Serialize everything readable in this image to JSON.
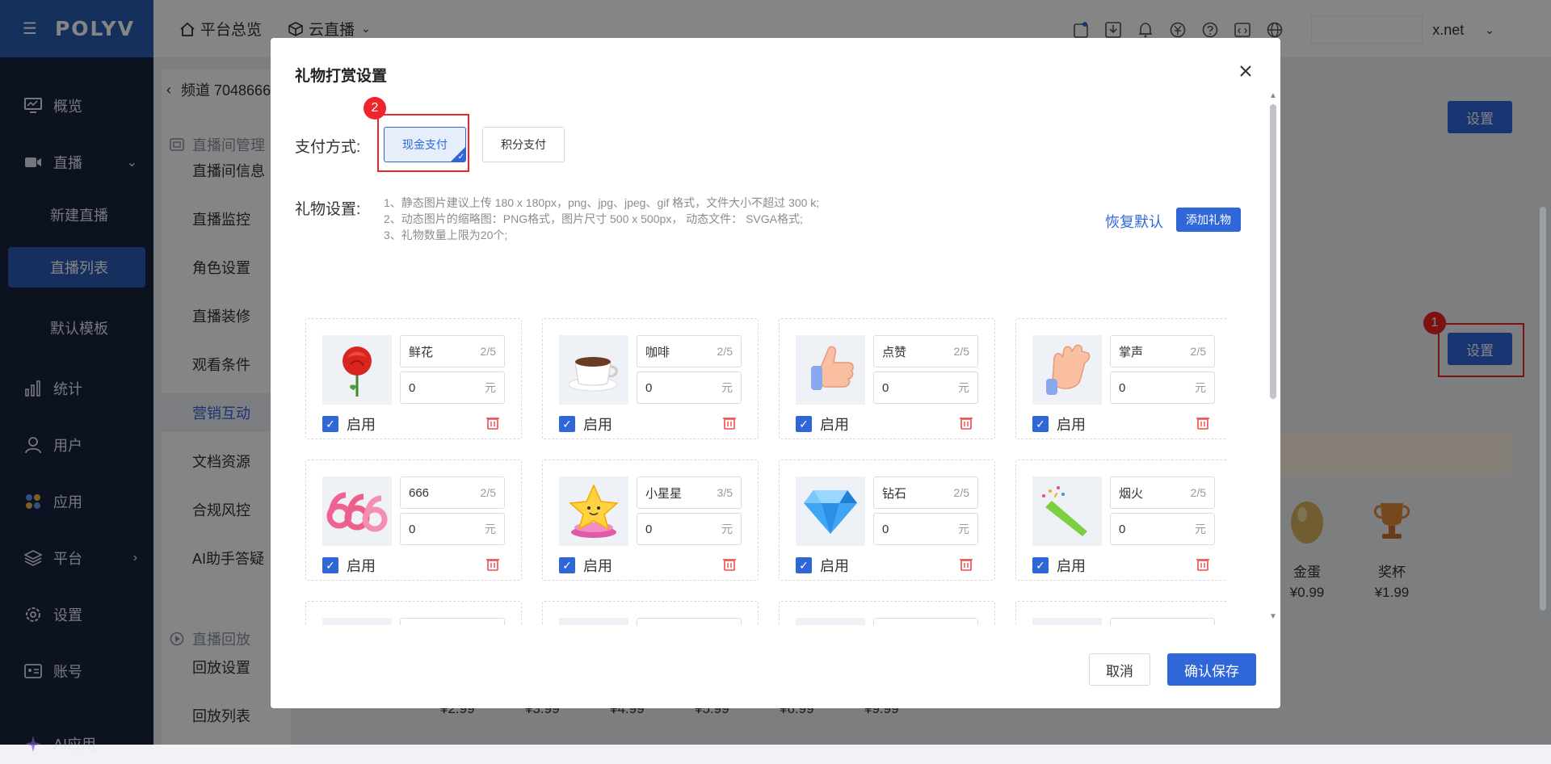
{
  "brand": {
    "logo": "POLYV"
  },
  "sidebar": {
    "items": [
      {
        "label": "概览",
        "icon": "monitor-icon"
      },
      {
        "label": "直播",
        "icon": "video-icon"
      },
      {
        "label": "统计",
        "icon": "bar-chart-icon"
      },
      {
        "label": "用户",
        "icon": "user-icon"
      },
      {
        "label": "应用",
        "icon": "apps-icon"
      },
      {
        "label": "平台",
        "icon": "layers-icon"
      },
      {
        "label": "设置",
        "icon": "gear-icon"
      },
      {
        "label": "账号",
        "icon": "id-card-icon"
      },
      {
        "label": "AI应用",
        "icon": "sparkle-icon"
      }
    ],
    "live_sub": [
      "新建直播",
      "直播列表",
      "默认模板"
    ],
    "active_sub": "直播列表"
  },
  "topbar": {
    "links": [
      "平台总览",
      "云直播"
    ],
    "user_domain": "x.net"
  },
  "channel": {
    "title": "频道 7048666",
    "group1": "直播间管理",
    "items": [
      "直播间信息",
      "直播监控",
      "角色设置",
      "直播装修",
      "观看条件",
      "营销互动",
      "文档资源",
      "合规风控",
      "AI助手答疑"
    ],
    "active": "营销互动",
    "group2": "直播回放",
    "items2": [
      "回放设置",
      "回放列表"
    ]
  },
  "background": {
    "settings_button": "设置",
    "gifts": [
      {
        "name": "金蛋",
        "price": "¥0.99"
      },
      {
        "name": "奖杯",
        "price": "¥1.99"
      }
    ],
    "price_row": [
      "¥2.99",
      "¥3.99",
      "¥4.99",
      "¥5.99",
      "¥6.99",
      "¥9.99"
    ]
  },
  "annotations": [
    "1",
    "2"
  ],
  "dialog": {
    "title": "礼物打赏设置",
    "payment_label": "支付方式:",
    "payment_options": [
      "现金支付",
      "积分支付"
    ],
    "gift_label": "礼物设置:",
    "rules": [
      "1、静态图片建议上传 180 x 180px，png、jpg、jpeg、gif 格式，文件大小不超过 300 k;",
      "2、动态图片的缩略图：PNG格式，图片尺寸 500 x 500px， 动态文件： SVGA格式;",
      "3、礼物数量上限为20个;"
    ],
    "restore_default": "恢复默认",
    "add_gift": "添加礼物",
    "enable_label": "启用",
    "currency_unit": "元",
    "gifts": [
      {
        "name": "鲜花",
        "count": "2/5",
        "price": "0",
        "icon": "rose-icon"
      },
      {
        "name": "咖啡",
        "count": "2/5",
        "price": "0",
        "icon": "coffee-icon"
      },
      {
        "name": "点赞",
        "count": "2/5",
        "price": "0",
        "icon": "thumbs-up-icon"
      },
      {
        "name": "掌声",
        "count": "2/5",
        "price": "0",
        "icon": "clap-icon"
      },
      {
        "name": "666",
        "count": "2/5",
        "price": "0",
        "icon": "number-666-icon"
      },
      {
        "name": "小星星",
        "count": "3/5",
        "price": "0",
        "icon": "star-icon"
      },
      {
        "name": "钻石",
        "count": "2/5",
        "price": "0",
        "icon": "diamond-icon"
      },
      {
        "name": "烟火",
        "count": "2/5",
        "price": "0",
        "icon": "party-popper-icon"
      }
    ],
    "cancel": "取消",
    "save": "确认保存"
  }
}
